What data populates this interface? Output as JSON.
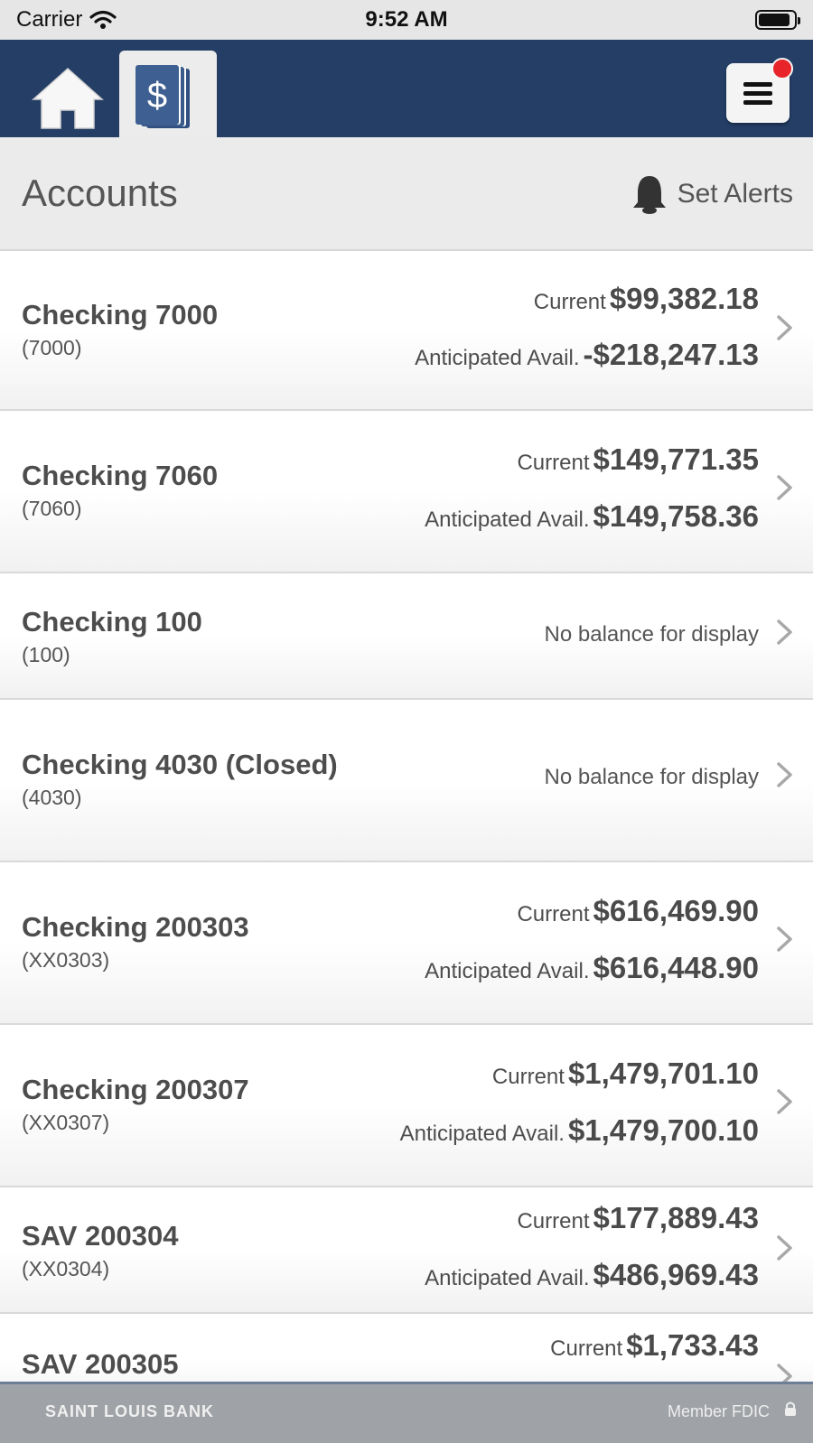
{
  "status_bar": {
    "carrier": "Carrier",
    "time": "9:52 AM",
    "battery_level": 0.9
  },
  "nav": {
    "home_icon": "home-icon",
    "accounts_icon": "dollar-cards-icon",
    "menu_icon": "hamburger-menu-icon",
    "brand_color": "#243e66",
    "badge_color": "#e8232a"
  },
  "header": {
    "title": "Accounts",
    "set_alerts_label": "Set Alerts",
    "set_alerts_icon": "bell-icon"
  },
  "accounts": [
    {
      "name": "Checking 7000",
      "number": "(7000)",
      "current_label": "Current",
      "current": "$99,382.18",
      "anticipated_label": "Anticipated Avail.",
      "anticipated": "-$218,247.13"
    },
    {
      "name": "Checking 7060",
      "number": "(7060)",
      "current_label": "Current",
      "current": "$149,771.35",
      "anticipated_label": "Anticipated Avail.",
      "anticipated": "$149,758.36"
    },
    {
      "name": "Checking 100",
      "number": "(100)",
      "no_balance": "No balance for display"
    },
    {
      "name": "Checking 4030 (Closed)",
      "number": "(4030)",
      "no_balance": "No balance for display"
    },
    {
      "name": "Checking 200303",
      "number": "(XX0303)",
      "current_label": "Current",
      "current": "$616,469.90",
      "anticipated_label": "Anticipated Avail.",
      "anticipated": "$616,448.90"
    },
    {
      "name": "Checking 200307",
      "number": "(XX0307)",
      "current_label": "Current",
      "current": "$1,479,701.10",
      "anticipated_label": "Anticipated Avail.",
      "anticipated": "$1,479,700.10"
    },
    {
      "name": "SAV 200304",
      "number": "(XX0304)",
      "current_label": "Current",
      "current": "$177,889.43",
      "anticipated_label": "Anticipated Avail.",
      "anticipated": "$486,969.43"
    },
    {
      "name": "SAV 200305",
      "number": "",
      "current_label": "Current",
      "current": "$1,733.43"
    }
  ],
  "footer": {
    "bank_name": "SAINT LOUIS BANK",
    "fdic": "Member FDIC",
    "lock_icon": "lock-icon"
  }
}
